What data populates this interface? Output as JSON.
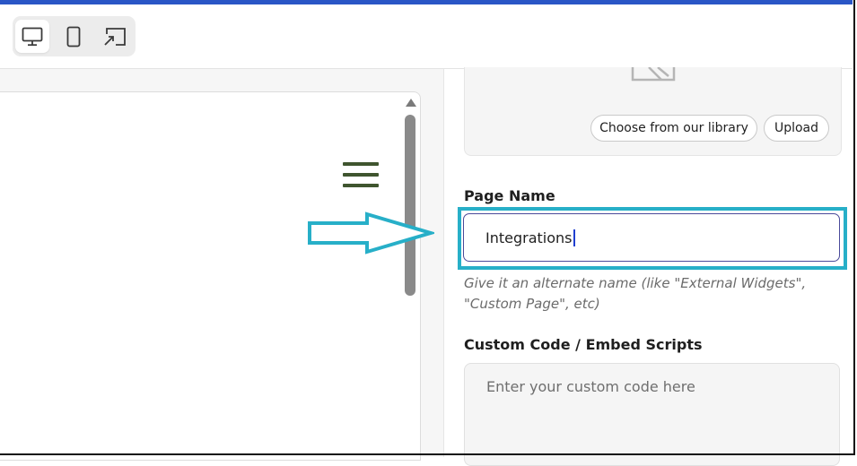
{
  "toolbar": {
    "devices": [
      {
        "name": "desktop",
        "icon": "monitor-icon",
        "active": true
      },
      {
        "name": "mobile",
        "icon": "phone-icon",
        "active": false
      },
      {
        "name": "fullscreen",
        "icon": "expand-window-icon",
        "active": false
      }
    ]
  },
  "preview": {
    "menu_icon": "hamburger-menu-icon",
    "menu_color": "#3f552f"
  },
  "annotation": {
    "arrow_icon": "arrow-right-icon",
    "highlight_color": "#27afc8"
  },
  "settings": {
    "image": {
      "placeholder_icon": "image-placeholder-icon",
      "library_button": "Choose from our library",
      "upload_button": "Upload"
    },
    "page_name": {
      "label": "Page Name",
      "value": "Integrations",
      "helper": "Give it an alternate name (like \"External Widgets\", \"Custom Page\", etc)"
    },
    "custom_code": {
      "label": "Custom Code / Embed Scripts",
      "placeholder": "Enter your custom code here"
    }
  },
  "colors": {
    "accent_top_bar": "#2a56c6",
    "input_border": "#4a4a9a"
  }
}
